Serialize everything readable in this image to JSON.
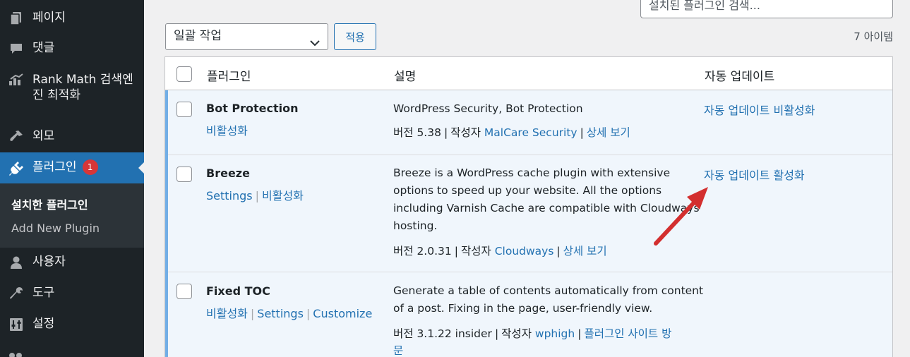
{
  "sidebar": {
    "items": [
      {
        "label": "페이지",
        "icon": "pages-icon"
      },
      {
        "label": "댓글",
        "icon": "comments-icon"
      },
      {
        "label": "Rank Math 검색엔진 최적화",
        "line1": "Rank Math 검색엔",
        "line2": "진 최적화",
        "icon": "rankmath-icon"
      },
      {
        "label": "외모",
        "icon": "appearance-icon"
      },
      {
        "label": "플러그인",
        "icon": "plugins-icon",
        "badge": "1"
      },
      {
        "label": "사용자",
        "icon": "users-icon"
      },
      {
        "label": "도구",
        "icon": "tools-icon"
      },
      {
        "label": "설정",
        "icon": "settings-icon"
      }
    ],
    "submenu": [
      "설치한 플러그인",
      "Add New Plugin"
    ]
  },
  "search": {
    "placeholder": "설치된 플러그인 검색..."
  },
  "bulk": {
    "selected": "일괄 작업",
    "apply": "적용",
    "count": "7 아이템"
  },
  "table": {
    "headers": [
      "플러그인",
      "설명",
      "자동 업데이트"
    ],
    "rows": [
      {
        "name": "Bot Protection",
        "actions": [
          "비활성화"
        ],
        "description": "WordPress Security, Bot Protection",
        "version": "버전 5.38",
        "by": "작성자",
        "author": "MalCare Security",
        "details": "상세 보기",
        "auto_update": "자동 업데이트 비활성화"
      },
      {
        "name": "Breeze",
        "actions": [
          "Settings",
          "비활성화"
        ],
        "description_lines": [
          "Breeze is a WordPress cache plugin with extensive",
          "options to speed up your website. All the options",
          "including Varnish Cache are compatible with Cloudways",
          "hosting."
        ],
        "version": "버전 2.0.31",
        "by": "작성자",
        "author": "Cloudways",
        "details": "상세 보기",
        "auto_update": "자동 업데이트 활성화"
      },
      {
        "name": "Fixed TOC",
        "actions": [
          "비활성화",
          "Settings",
          "Customize"
        ],
        "description_lines": [
          "Generate a table of contents automatically from content",
          "of a post. Fixing in the page, user-friendly view."
        ],
        "version": "버전 3.1.22 insider",
        "by": "작성자",
        "author": "wphigh",
        "details_line1": "플러그인 사이트 방",
        "details_line2": "문"
      }
    ]
  },
  "colors": {
    "accent": "#2271b1",
    "sidebar": "#1d2327",
    "badge": "#d63638",
    "arrow": "#d32f2f",
    "active_row": "#f0f6fc"
  }
}
